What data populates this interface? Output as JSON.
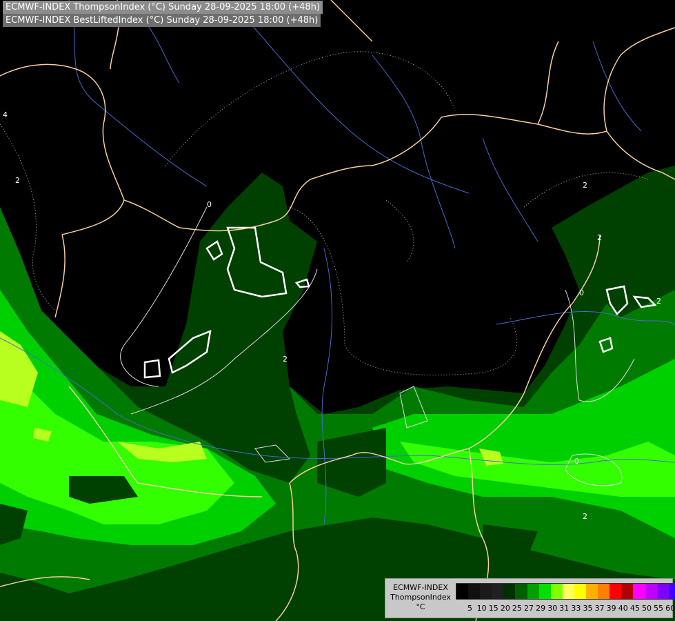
{
  "header": {
    "line1": "ECMWF-INDEX ThompsonIndex (°C) Sunday 28-09-2025 18:00 (+48h)",
    "line2": "ECMWF-INDEX BestLiftedIndex (°C) Sunday 28-09-2025 18:00 (+48h)"
  },
  "legend": {
    "line1": "ECMWF-INDEX",
    "line2": "ThompsonIndex",
    "line3": "°C",
    "swatches": [
      "#000000",
      "#101010",
      "#1a1a1a",
      "#202020",
      "#003000",
      "#006000",
      "#00a000",
      "#00e000",
      "#80ff00",
      "#ffff60",
      "#ffff00",
      "#ffb000",
      "#ff8000",
      "#ff0000",
      "#b00000",
      "#ff00ff",
      "#c000ff",
      "#8000ff",
      "#4000ff",
      "#0000ff"
    ],
    "ticks": [
      "5",
      "10",
      "15",
      "20",
      "25",
      "27",
      "29",
      "30",
      "31",
      "33",
      "35",
      "37",
      "39",
      "40",
      "45",
      "50",
      "55",
      "60"
    ]
  },
  "contour_labels": [
    "0",
    "2",
    "4",
    "2",
    "2",
    "2",
    "0",
    "0",
    "2",
    "2"
  ],
  "colors": {
    "dark_green": "#003c00",
    "mid_green": "#007a00",
    "bright_green": "#00d000",
    "light_green": "#33ff00",
    "yellow_green": "#ccff33",
    "border": "#f5d0a0",
    "river": "#4a6ad0"
  }
}
